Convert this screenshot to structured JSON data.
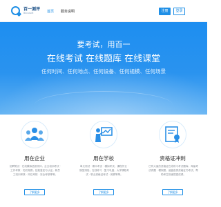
{
  "header": {
    "logo": {
      "name": "百一测评",
      "sub": "Blbusoft"
    },
    "nav": [
      {
        "label": "首页",
        "active": true
      },
      {
        "label": "服务说明",
        "active": false
      }
    ],
    "register_label": "注册",
    "login_label": "登录"
  },
  "hero": {
    "line1": "要考试，用百一",
    "line2": "在线考试  在线题库  在线课堂",
    "line3_parts": [
      "任何时间",
      "任何地点",
      "任何设备",
      "任何规模",
      "任何场景"
    ],
    "separator": "、"
  },
  "features": [
    {
      "title": "用在企业",
      "desc": "招聘笔试 · 在线模拟选拔测评，企业培训考试 · 工作考核 · 知识竞赛，技能鉴定与认证，新员工培训考核 · 岗位考核 · 安全考核等等。",
      "button": "了解更多"
    },
    {
      "title": "用在学校",
      "desc": "单元测试 · 期中考试 · 模拟考试，课程作业 · 随堂测验，在线练习 · 复习巩固，大学课程考试 · 职业资格证考试 · 竞赛等等。",
      "button": "了解更多"
    },
    {
      "title": "资格证冲刺",
      "desc": "已有大量的资格证在线练习考试题库，海量考试真题 · 模拟题，涵盖各类资格证书考试，帮助考生快速提高成绩。",
      "button": "了解更多"
    }
  ],
  "colors": {
    "primary": "#1f8fe6",
    "hero_top": "#1d8ef0",
    "hero_bottom": "#64b3f3"
  },
  "icons": [
    "users-group-icon",
    "teacher-board-icon",
    "certificate-icon"
  ]
}
